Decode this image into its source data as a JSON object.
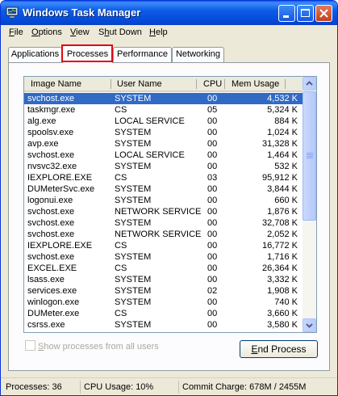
{
  "window": {
    "title": "Windows Task Manager"
  },
  "menu": [
    {
      "label": "File",
      "hotkey_index": 0
    },
    {
      "label": "Options",
      "hotkey_index": 0
    },
    {
      "label": "View",
      "hotkey_index": 0
    },
    {
      "label": "Shut Down",
      "hotkey_index": 1
    },
    {
      "label": "Help",
      "hotkey_index": 0
    }
  ],
  "tabs": [
    "Applications",
    "Processes",
    "Performance",
    "Networking"
  ],
  "active_tab": "Processes",
  "columns": {
    "name": "Image Name",
    "user": "User Name",
    "cpu": "CPU",
    "mem": "Mem Usage"
  },
  "processes": [
    {
      "name": "svchost.exe",
      "user": "SYSTEM",
      "cpu": "00",
      "mem": "4,532 K",
      "selected": true
    },
    {
      "name": "taskmgr.exe",
      "user": "CS",
      "cpu": "05",
      "mem": "5,324 K"
    },
    {
      "name": "alg.exe",
      "user": "LOCAL SERVICE",
      "cpu": "00",
      "mem": "884 K"
    },
    {
      "name": "spoolsv.exe",
      "user": "SYSTEM",
      "cpu": "00",
      "mem": "1,024 K"
    },
    {
      "name": "avp.exe",
      "user": "SYSTEM",
      "cpu": "00",
      "mem": "31,328 K"
    },
    {
      "name": "svchost.exe",
      "user": "LOCAL SERVICE",
      "cpu": "00",
      "mem": "1,464 K"
    },
    {
      "name": "nvsvc32.exe",
      "user": "SYSTEM",
      "cpu": "00",
      "mem": "532 K"
    },
    {
      "name": "IEXPLORE.EXE",
      "user": "CS",
      "cpu": "03",
      "mem": "95,912 K"
    },
    {
      "name": "DUMeterSvc.exe",
      "user": "SYSTEM",
      "cpu": "00",
      "mem": "3,844 K"
    },
    {
      "name": "logonui.exe",
      "user": "SYSTEM",
      "cpu": "00",
      "mem": "660 K"
    },
    {
      "name": "svchost.exe",
      "user": "NETWORK SERVICE",
      "cpu": "00",
      "mem": "1,876 K"
    },
    {
      "name": "svchost.exe",
      "user": "SYSTEM",
      "cpu": "00",
      "mem": "32,708 K"
    },
    {
      "name": "svchost.exe",
      "user": "NETWORK SERVICE",
      "cpu": "00",
      "mem": "2,052 K"
    },
    {
      "name": "IEXPLORE.EXE",
      "user": "CS",
      "cpu": "00",
      "mem": "16,772 K"
    },
    {
      "name": "svchost.exe",
      "user": "SYSTEM",
      "cpu": "00",
      "mem": "1,716 K"
    },
    {
      "name": "EXCEL.EXE",
      "user": "CS",
      "cpu": "00",
      "mem": "26,364 K"
    },
    {
      "name": "lsass.exe",
      "user": "SYSTEM",
      "cpu": "00",
      "mem": "3,332 K"
    },
    {
      "name": "services.exe",
      "user": "SYSTEM",
      "cpu": "02",
      "mem": "1,908 K"
    },
    {
      "name": "winlogon.exe",
      "user": "SYSTEM",
      "cpu": "00",
      "mem": "740 K"
    },
    {
      "name": "DUMeter.exe",
      "user": "CS",
      "cpu": "00",
      "mem": "3,660 K"
    },
    {
      "name": "csrss.exe",
      "user": "SYSTEM",
      "cpu": "00",
      "mem": "3,580 K"
    }
  ],
  "show_all_label": "Show processes from all users",
  "end_process_label": "End Process",
  "status": {
    "processes": "Processes: 36",
    "cpu": "CPU Usage: 10%",
    "commit": "Commit Charge: 678M / 2455M"
  },
  "colors": {
    "title_bar": "#0c5ce8",
    "selection": "#316ac5",
    "highlight_box": "#e0070f"
  }
}
